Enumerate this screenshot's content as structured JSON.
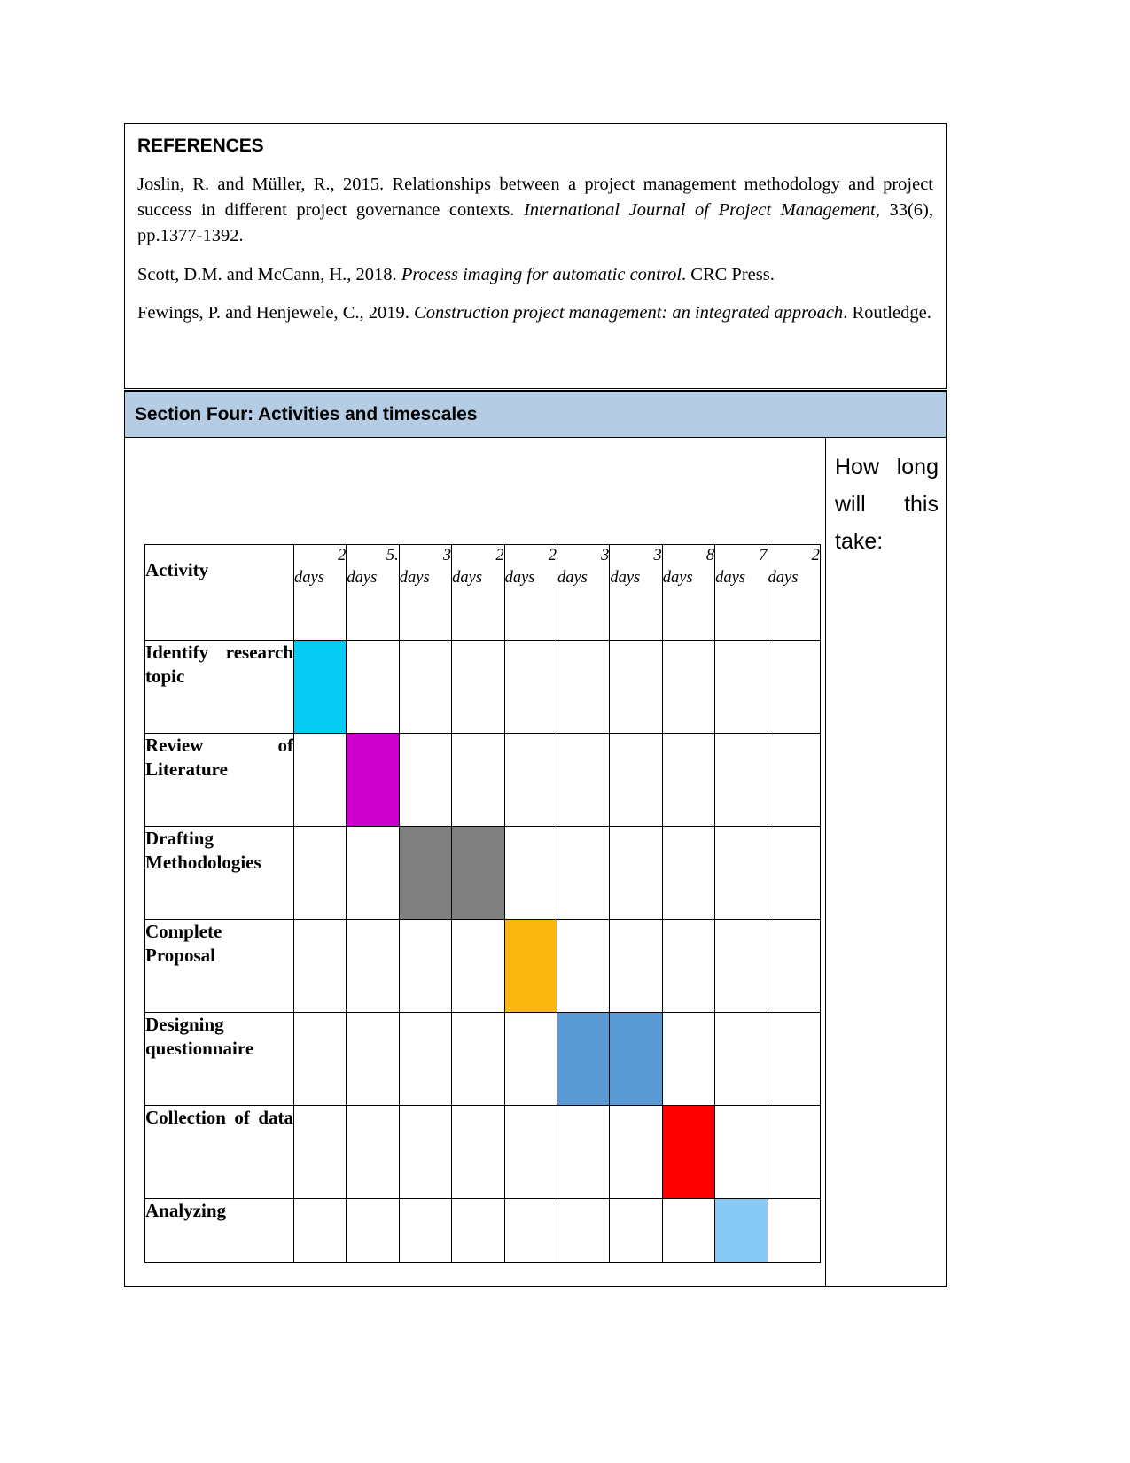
{
  "references": {
    "heading": "REFERENCES",
    "entries": [
      {
        "parts": [
          {
            "text": "Joslin, R. and Müller, R., 2015. Relationships between a project management methodology and project success in different project governance contexts. ",
            "italic": false
          },
          {
            "text": "International Journal of Project Management",
            "italic": true
          },
          {
            "text": ", 33(6), pp.1377-1392.",
            "italic": false
          }
        ]
      },
      {
        "parts": [
          {
            "text": "Scott, D.M. and McCann, H., 2018. ",
            "italic": false
          },
          {
            "text": "Process imaging for automatic control",
            "italic": true
          },
          {
            "text": ". CRC Press.",
            "italic": false
          }
        ]
      },
      {
        "parts": [
          {
            "text": "Fewings, P. and Henjewele, C., 2019. ",
            "italic": false
          },
          {
            "text": "Construction project management: an integrated approach",
            "italic": true
          },
          {
            "text": ". Routledge.",
            "italic": false
          }
        ]
      }
    ]
  },
  "section": {
    "title": "Section Four: Activities and timescales",
    "band_color": "#b4cde4"
  },
  "right_column": {
    "prompt": "How long will this take:"
  },
  "chart_data": {
    "type": "table",
    "title": "Section Four: Activities and timescales",
    "activity_header": "Activity",
    "duration_unit": "days",
    "columns": [
      {
        "index": 1,
        "number": "2",
        "unit": "days"
      },
      {
        "index": 2,
        "number": "5.",
        "unit": "days"
      },
      {
        "index": 3,
        "number": "3",
        "unit": "days"
      },
      {
        "index": 4,
        "number": "2",
        "unit": "days"
      },
      {
        "index": 5,
        "number": "2",
        "unit": "days"
      },
      {
        "index": 6,
        "number": "3",
        "unit": "days"
      },
      {
        "index": 7,
        "number": "3",
        "unit": "days"
      },
      {
        "index": 8,
        "number": "8",
        "unit": "days"
      },
      {
        "index": 9,
        "number": "7",
        "unit": "days"
      },
      {
        "index": 10,
        "number": "2",
        "unit": "days"
      }
    ],
    "rows": [
      {
        "activity": "Identify research topic",
        "justify_first_line": false,
        "bar_start": 1,
        "bar_end": 1,
        "color": "#06cbf5"
      },
      {
        "activity": "Review of Literature",
        "justify_first_line": true,
        "bar_start": 2,
        "bar_end": 2,
        "color": "#cc00cc"
      },
      {
        "activity": "Drafting Methodologies",
        "justify_first_line": false,
        "bar_start": 3,
        "bar_end": 4,
        "color": "#808080"
      },
      {
        "activity": "Complete Proposal",
        "justify_first_line": false,
        "bar_start": 5,
        "bar_end": 5,
        "color": "#fab80e"
      },
      {
        "activity": "Designing questionnaire",
        "justify_first_line": false,
        "bar_start": 6,
        "bar_end": 7,
        "color": "#5b9bd5"
      },
      {
        "activity": "Collection of data",
        "justify_first_line": true,
        "bar_start": 8,
        "bar_end": 8,
        "color": "#fe0000"
      },
      {
        "activity": "Analyzing",
        "justify_first_line": false,
        "bar_start": 9,
        "bar_end": 9,
        "color": "#86caf5"
      }
    ]
  }
}
